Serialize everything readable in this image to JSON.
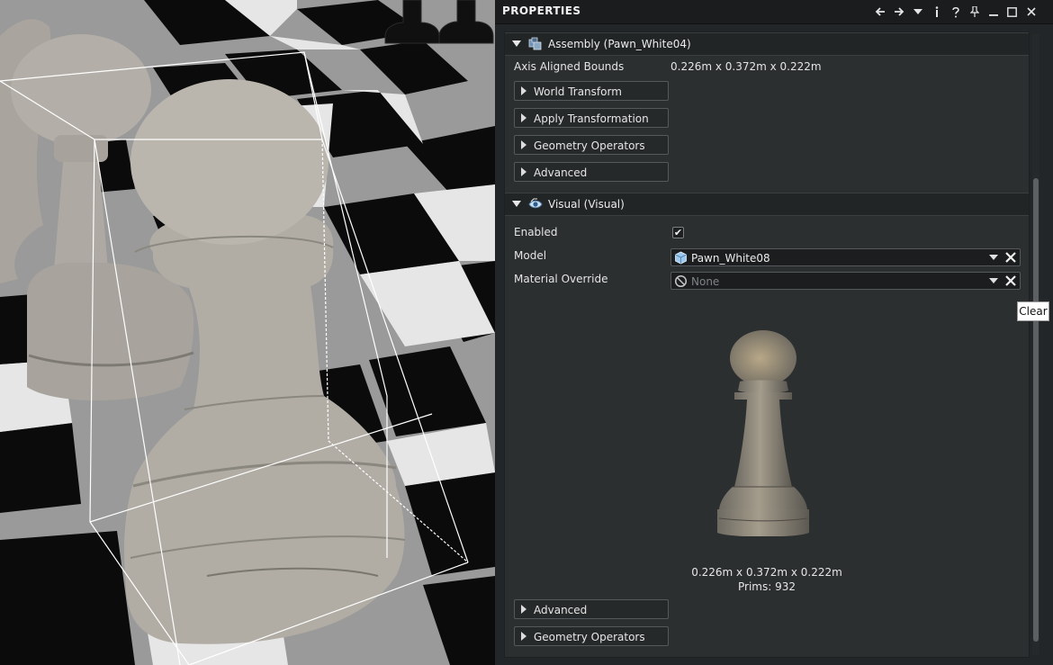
{
  "panel": {
    "title": "PROPERTIES",
    "toolbar_icons": [
      "back-arrow-icon",
      "forward-arrow-icon",
      "dropdown-icon",
      "info-icon",
      "help-icon",
      "pin-icon",
      "minimize-icon",
      "maximize-icon",
      "close-icon"
    ]
  },
  "assembly": {
    "header": "Assembly (Pawn_White04)",
    "bounds_label": "Axis Aligned Bounds",
    "bounds_value": "0.226m x 0.372m x 0.222m",
    "groups": [
      "World Transform",
      "Apply Transformation",
      "Geometry Operators",
      "Advanced"
    ]
  },
  "visual": {
    "header": "Visual (Visual)",
    "enabled_label": "Enabled",
    "enabled_checked": true,
    "enabled_mark": "✔",
    "model_label": "Model",
    "model_value": "Pawn_White08",
    "material_label": "Material Override",
    "material_value": "None",
    "preview_dimensions": "0.226m x 0.372m x 0.222m",
    "preview_prims": "Prims: 932",
    "groups": [
      "Advanced",
      "Geometry Operators"
    ]
  },
  "tooltip": "Clear",
  "colors": {
    "panel_bg": "#2c2f30",
    "header_bg": "#222526",
    "titlebar_bg": "#1a1c1d",
    "pawn_white": "#b1ada5"
  }
}
